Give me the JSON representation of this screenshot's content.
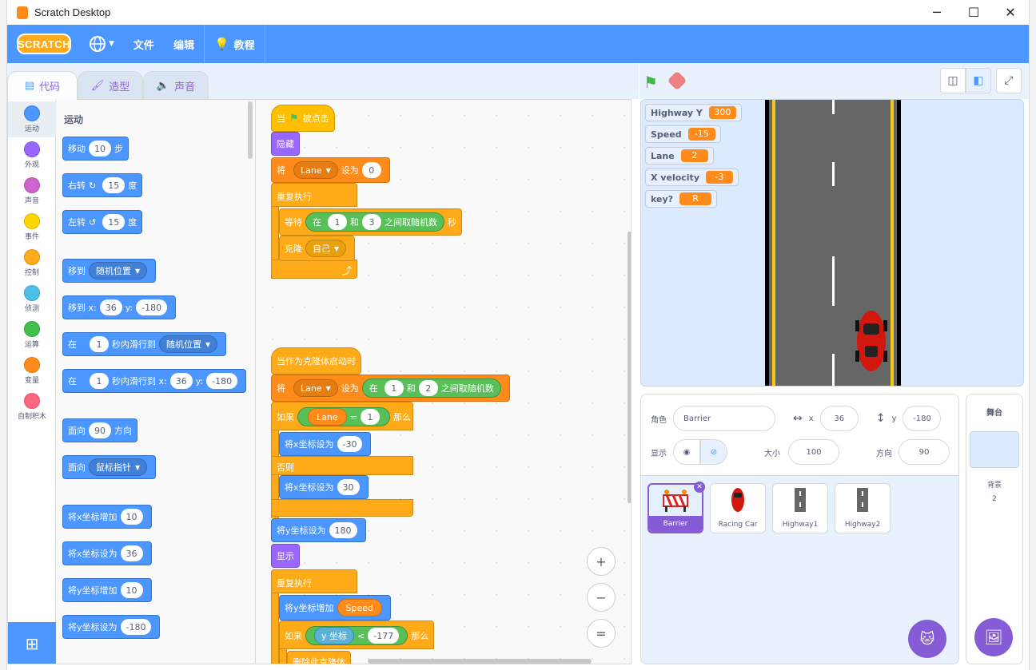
{
  "window": {
    "title": "Scratch Desktop",
    "min": "─",
    "max": "☐",
    "close": "✕"
  },
  "menu": {
    "logo": "SCRATCH",
    "lang_icon": "globe-icon",
    "file": "文件",
    "edit": "编辑",
    "tutorials": "教程"
  },
  "tabs": {
    "code": "代码",
    "costumes": "造型",
    "sounds": "声音"
  },
  "categories": [
    {
      "label": "运动",
      "color": "#4c97ff"
    },
    {
      "label": "外观",
      "color": "#9966ff"
    },
    {
      "label": "声音",
      "color": "#cf63cf"
    },
    {
      "label": "事件",
      "color": "#ffd500"
    },
    {
      "label": "控制",
      "color": "#ffab19"
    },
    {
      "label": "侦测",
      "color": "#4cbfe6"
    },
    {
      "label": "运算",
      "color": "#40bf4a"
    },
    {
      "label": "变量",
      "color": "#ff8c1a"
    },
    {
      "label": "自制积木",
      "color": "#ff6680"
    }
  ],
  "palette": {
    "header": "运动",
    "move": {
      "pre": "移动",
      "val": "10",
      "post": "步"
    },
    "turn_right": {
      "pre": "右转",
      "val": "15",
      "post": "度"
    },
    "turn_left": {
      "pre": "左转",
      "val": "15",
      "post": "度"
    },
    "goto": {
      "pre": "移到",
      "dd": "随机位置"
    },
    "goto_xy": {
      "pre": "移到 x:",
      "x": "36",
      "ylbl": "y:",
      "y": "-180"
    },
    "glide": {
      "pre": "在",
      "val": "1",
      "mid": "秒内滑行到",
      "dd": "随机位置"
    },
    "glide_xy": {
      "pre": "在",
      "val": "1",
      "mid": "秒内滑行到 x:",
      "x": "36",
      "ylbl": "y:",
      "y": "-180"
    },
    "point_dir": {
      "pre": "面向",
      "val": "90",
      "post": "方向"
    },
    "point_towards": {
      "pre": "面向",
      "dd": "鼠标指针"
    },
    "change_x": {
      "pre": "将x坐标增加",
      "val": "10"
    },
    "set_x": {
      "pre": "将x坐标设为",
      "val": "36"
    },
    "change_y": {
      "pre": "将y坐标增加",
      "val": "10"
    },
    "set_y": {
      "pre": "将y坐标设为",
      "val": "-180"
    }
  },
  "script1": {
    "hat_pre": "当",
    "hat_post": "被点击",
    "hide": "隐藏",
    "set_pre": "将",
    "set_var": "Lane",
    "set_mid": "设为",
    "set_val": "0",
    "forever": "重复执行",
    "wait_pre": "等待",
    "wait_in": "在",
    "wait_a": "1",
    "wait_and": "和",
    "wait_b": "3",
    "wait_rand": "之间取随机数",
    "wait_post": "秒",
    "clone_pre": "克隆",
    "clone_dd": "自己"
  },
  "script2": {
    "hat": "当作为克隆体启动时",
    "set_pre": "将",
    "set_var": "Lane",
    "set_mid": "设为",
    "rand_in": "在",
    "rand_a": "1",
    "rand_and": "和",
    "rand_b": "2",
    "rand_post": "之间取随机数",
    "if_pre": "如果",
    "if_var": "Lane",
    "if_eq": "=",
    "if_val": "1",
    "if_post": "那么",
    "setx1_pre": "将x坐标设为",
    "setx1_val": "-30",
    "else": "否则",
    "setx2_pre": "将x坐标设为",
    "setx2_val": "30",
    "sety_pre": "将y坐标设为",
    "sety_val": "180",
    "show": "显示",
    "forever": "重复执行",
    "changey_pre": "将y坐标增加",
    "changey_var": "Speed",
    "if2_pre": "如果",
    "if2_sense": "y 坐标",
    "if2_lt": "<",
    "if2_val": "-177",
    "if2_post": "那么",
    "delete": "删除此克隆体"
  },
  "zoom": {
    "in": "+",
    "out": "−",
    "reset": "="
  },
  "monitors": [
    {
      "label": "Highway Y",
      "value": "300"
    },
    {
      "label": "Speed",
      "value": "-15"
    },
    {
      "label": "Lane",
      "value": "2"
    },
    {
      "label": "X velocity",
      "value": "-3"
    },
    {
      "label": "key?",
      "value": "R"
    }
  ],
  "spriteinfo": {
    "sprite_lbl": "角色",
    "sprite_name": "Barrier",
    "x_lbl": "x",
    "x_val": "36",
    "y_lbl": "y",
    "y_val": "-180",
    "show_lbl": "显示",
    "size_lbl": "大小",
    "size_val": "100",
    "dir_lbl": "方向",
    "dir_val": "90"
  },
  "sprites": [
    {
      "name": "Barrier",
      "icon": "barrier-icon"
    },
    {
      "name": "Racing Car",
      "icon": "car-icon"
    },
    {
      "name": "Highway1",
      "icon": "highway-icon"
    },
    {
      "name": "Highway2",
      "icon": "highway-icon"
    }
  ],
  "stagepanel": {
    "title": "舞台",
    "bg_lbl": "背景",
    "bg_count": "2"
  }
}
